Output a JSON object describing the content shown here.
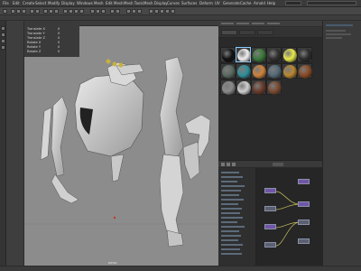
{
  "menubar": {
    "items": [
      "File",
      "Edit",
      "Create",
      "Select",
      "Modify",
      "Display",
      "Windows",
      "Mesh",
      "Edit Mesh",
      "Mesh Tools",
      "Mesh Display",
      "Curves",
      "Surfaces",
      "Deform",
      "UV",
      "Generate",
      "Cache",
      "Arnold",
      "Help"
    ]
  },
  "channel_box": {
    "rows": [
      {
        "label": "Translate X",
        "value": "0"
      },
      {
        "label": "Translate Y",
        "value": "0"
      },
      {
        "label": "Translate Z",
        "value": "0"
      },
      {
        "label": "Rotate X",
        "value": "0"
      },
      {
        "label": "Rotate Y",
        "value": "0"
      },
      {
        "label": "Rotate Z",
        "value": "0"
      }
    ]
  },
  "viewport": {
    "camera_label": "persp"
  },
  "hypershade": {
    "materials": [
      {
        "color": "#111111"
      },
      {
        "color": "#f0f0f0"
      },
      {
        "color": "#3a7a3a"
      },
      {
        "color": "#2f2f2f"
      },
      {
        "color": "#e8e84a"
      },
      {
        "color": "#2c2c2c"
      },
      {
        "color": "#5a6a60"
      },
      {
        "color": "#2f8f9a"
      },
      {
        "color": "#d0833a"
      },
      {
        "color": "#546a78"
      },
      {
        "color": "#b9872f"
      },
      {
        "color": "#8a4a24"
      },
      {
        "color": "#8a8a8a"
      },
      {
        "color": "#d0d0d0"
      },
      {
        "color": "#6a3a2a"
      },
      {
        "color": "#7a4a30"
      }
    ]
  },
  "colors": {
    "selection": "#88ccff",
    "node_header": "#6f56a8"
  }
}
